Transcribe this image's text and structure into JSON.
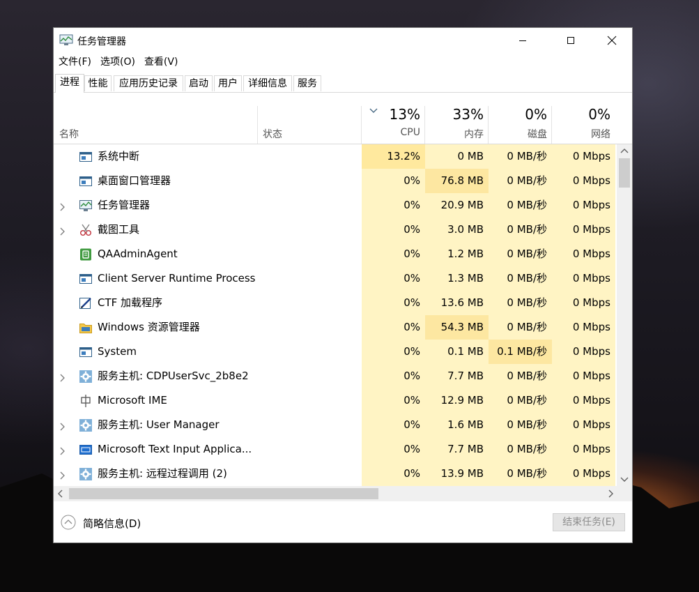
{
  "window": {
    "title": "任务管理器"
  },
  "menu": [
    "文件(F)",
    "选项(O)",
    "查看(V)"
  ],
  "tabs": [
    "进程",
    "性能",
    "应用历史记录",
    "启动",
    "用户",
    "详细信息",
    "服务"
  ],
  "active_tab": "进程",
  "columns": {
    "name": "名称",
    "status": "状态",
    "cpu": {
      "pct": "13%",
      "label": "CPU"
    },
    "memory": {
      "pct": "33%",
      "label": "内存"
    },
    "disk": {
      "pct": "0%",
      "label": "磁盘"
    },
    "network": {
      "pct": "0%",
      "label": "网络"
    }
  },
  "colors": {
    "heat_light": "#fff4c4",
    "heat_medium": "#ffe99e",
    "heat_strong": "#fde7a1"
  },
  "processes": [
    {
      "name": "系统中断",
      "icon": "system-window-icon",
      "expandable": false,
      "cpu": "13.2%",
      "memory": "0 MB",
      "disk": "0 MB/秒",
      "network": "0 Mbps"
    },
    {
      "name": "桌面窗口管理器",
      "icon": "system-window-icon",
      "expandable": false,
      "cpu": "0%",
      "memory": "76.8 MB",
      "disk": "0 MB/秒",
      "network": "0 Mbps"
    },
    {
      "name": "任务管理器",
      "icon": "task-manager-icon",
      "expandable": true,
      "cpu": "0%",
      "memory": "20.9 MB",
      "disk": "0 MB/秒",
      "network": "0 Mbps"
    },
    {
      "name": "截图工具",
      "icon": "snipping-tool-icon",
      "expandable": true,
      "cpu": "0%",
      "memory": "3.0 MB",
      "disk": "0 MB/秒",
      "network": "0 Mbps"
    },
    {
      "name": "QAAdminAgent",
      "icon": "green-agent-icon",
      "expandable": false,
      "cpu": "0%",
      "memory": "1.2 MB",
      "disk": "0 MB/秒",
      "network": "0 Mbps"
    },
    {
      "name": "Client Server Runtime Process",
      "icon": "system-window-icon",
      "expandable": false,
      "cpu": "0%",
      "memory": "1.3 MB",
      "disk": "0 MB/秒",
      "network": "0 Mbps"
    },
    {
      "name": "CTF 加载程序",
      "icon": "ctf-pen-icon",
      "expandable": false,
      "cpu": "0%",
      "memory": "13.6 MB",
      "disk": "0 MB/秒",
      "network": "0 Mbps"
    },
    {
      "name": "Windows 资源管理器",
      "icon": "folder-icon",
      "expandable": false,
      "cpu": "0%",
      "memory": "54.3 MB",
      "disk": "0 MB/秒",
      "network": "0 Mbps"
    },
    {
      "name": "System",
      "icon": "system-window-icon",
      "expandable": false,
      "cpu": "0%",
      "memory": "0.1 MB",
      "disk": "0.1 MB/秒",
      "network": "0 Mbps"
    },
    {
      "name": "服务主机: CDPUserSvc_2b8e2",
      "icon": "gear-icon",
      "expandable": true,
      "cpu": "0%",
      "memory": "7.7 MB",
      "disk": "0 MB/秒",
      "network": "0 Mbps"
    },
    {
      "name": "Microsoft IME",
      "icon": "ime-icon",
      "expandable": false,
      "cpu": "0%",
      "memory": "12.9 MB",
      "disk": "0 MB/秒",
      "network": "0 Mbps"
    },
    {
      "name": "服务主机: User Manager",
      "icon": "gear-icon",
      "expandable": true,
      "cpu": "0%",
      "memory": "1.6 MB",
      "disk": "0 MB/秒",
      "network": "0 Mbps"
    },
    {
      "name": "Microsoft Text Input Applica...",
      "icon": "text-input-icon",
      "expandable": true,
      "cpu": "0%",
      "memory": "7.7 MB",
      "disk": "0 MB/秒",
      "network": "0 Mbps"
    },
    {
      "name": "服务主机: 远程过程调用 (2)",
      "icon": "gear-icon",
      "expandable": true,
      "cpu": "0%",
      "memory": "13.9 MB",
      "disk": "0 MB/秒",
      "network": "0 Mbps"
    }
  ],
  "footer": {
    "fewer_details": "简略信息(D)",
    "end_task": "结束任务(E)"
  }
}
